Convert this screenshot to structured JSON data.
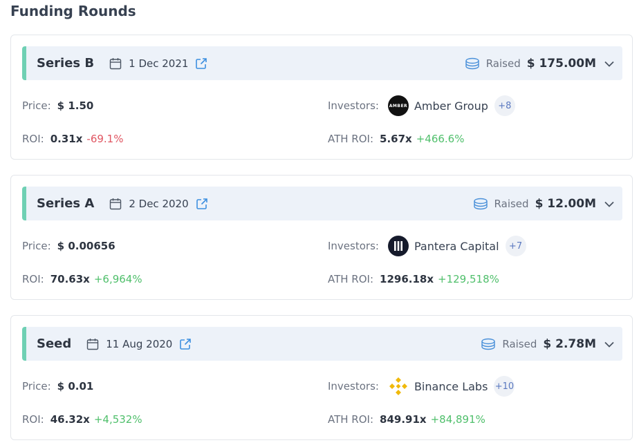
{
  "page": {
    "title": "Funding Rounds"
  },
  "labels": {
    "raised": "Raised",
    "price": "Price:",
    "roi": "ROI:",
    "investors": "Investors:",
    "ath_roi": "ATH ROI:"
  },
  "colors": {
    "accent_bar": "#6fd0b4",
    "header_bg": "#edf2f9",
    "negative": "#e05561",
    "positive": "#4fbf6b",
    "link_blue": "#3d8fe0"
  },
  "rounds": [
    {
      "name": "Series B",
      "date": "1 Dec 2021",
      "raised": "$ 175.00M",
      "price": "$ 1.50",
      "roi": "0.31x",
      "roi_change": "-69.1%",
      "investor_name": "Amber Group",
      "investor_logo_text": "AMBER",
      "investor_icon": "amber-group-logo",
      "investor_more": "+8",
      "ath_roi": "5.67x",
      "ath_roi_change": "+466.6%"
    },
    {
      "name": "Series A",
      "date": "2 Dec 2020",
      "raised": "$ 12.00M",
      "price": "$ 0.00656",
      "roi": "70.63x",
      "roi_change": "+6,964%",
      "investor_name": "Pantera Capital",
      "investor_icon": "pantera-capital-logo",
      "investor_more": "+7",
      "ath_roi": "1296.18x",
      "ath_roi_change": "+129,518%"
    },
    {
      "name": "Seed",
      "date": "11 Aug 2020",
      "raised": "$ 2.78M",
      "price": "$ 0.01",
      "roi": "46.32x",
      "roi_change": "+4,532%",
      "investor_name": "Binance Labs",
      "investor_icon": "binance-labs-logo",
      "investor_more": "+10",
      "ath_roi": "849.91x",
      "ath_roi_change": "+84,891%"
    }
  ]
}
